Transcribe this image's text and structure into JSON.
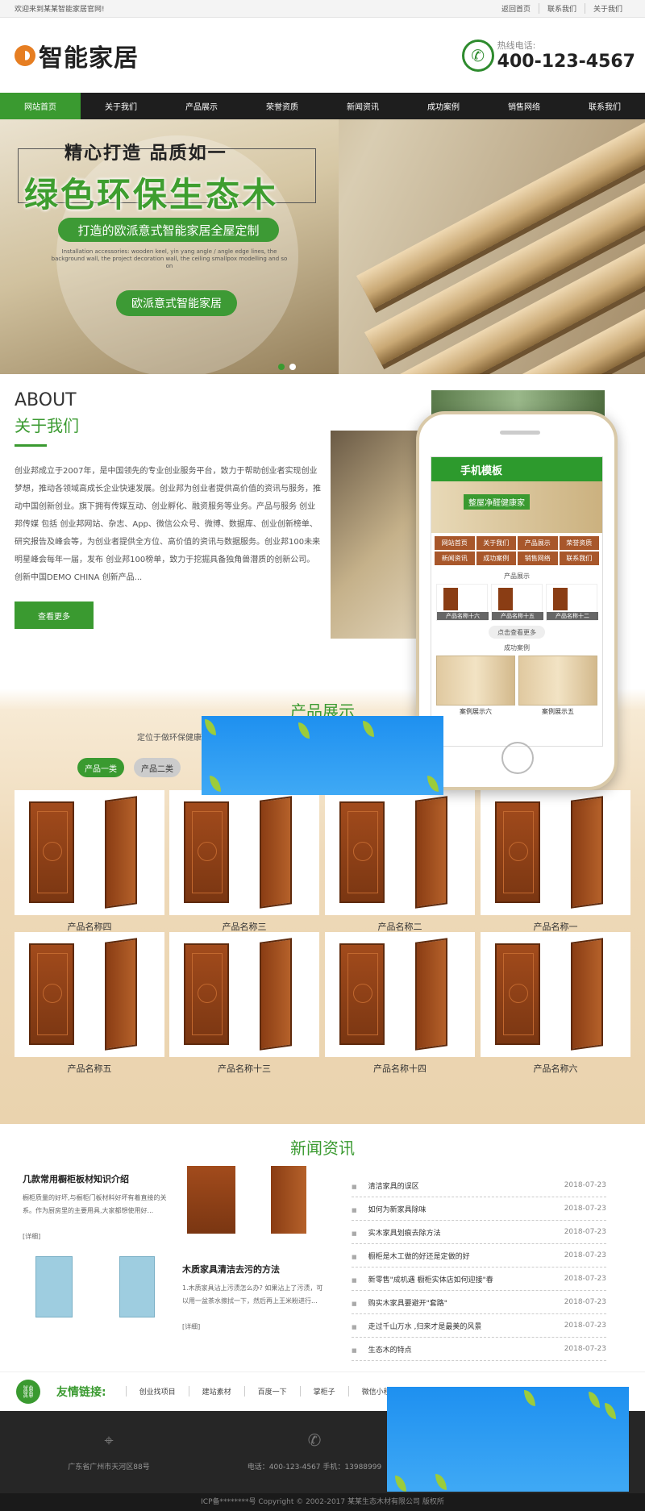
{
  "topbar": {
    "welcome": "欢迎来到某某智能家居官网!",
    "links": [
      "返回首页",
      "联系我们",
      "关于我们"
    ]
  },
  "header": {
    "logo_text": "智能家居",
    "hotline_label": "热线电话:",
    "hotline_number": "400-123-4567"
  },
  "nav": {
    "items": [
      "网站首页",
      "关于我们",
      "产品展示",
      "荣誉资质",
      "新闻资讯",
      "成功案例",
      "销售网络",
      "联系我们"
    ]
  },
  "banner": {
    "title1": "精心打造   品质如一",
    "title2": "绿色环保生态木",
    "pill1": "打造的欧派意式智能家居全屋定制",
    "english": "Installation accessories: wooden keel, yin yang angle / angle edge lines, the background wall, the project decoration wall, the ceiling smallpox modelling and so on",
    "pill2": "欧派意式智能家居"
  },
  "about": {
    "title_en": "ABOUT",
    "title_cn": "关于我们",
    "text": "创业邦成立于2007年，是中国领先的专业创业服务平台，致力于帮助创业者实现创业梦想，推动各领域高成长企业快速发展。创业邦为创业者提供高价值的资讯与服务，推动中国创新创业。旗下拥有传媒互动、创业孵化、融资服务等业务。产品与服务 创业邦传媒 包括 创业邦网站、杂志、App、微信公众号、微博、数据库、创业创新榜单、研究报告及峰会等，为创业者提供全方位、高价值的资讯与数据服务。创业邦100未来明星峰会每年一届，发布 创业邦100榜单，致力于挖掘具备独角兽潜质的创新公司。创新中国DEMO CHINA 创新产品...",
    "more_button": "查看更多"
  },
  "products": {
    "title": "产品展示",
    "subtitle": "定位于做环保健康",
    "tabs": [
      "产品一类",
      "产品二类"
    ],
    "items": [
      "产品名称四",
      "产品名称三",
      "产品名称二",
      "产品名称一",
      "产品名称五",
      "产品名称十三",
      "产品名称十四",
      "产品名称六"
    ]
  },
  "phone": {
    "header": "手机模板",
    "banner_text": "整屋净醛健康家",
    "nav": [
      "网站首页",
      "关于我们",
      "产品展示",
      "荣誉资质",
      "新闻资讯",
      "成功案例",
      "销售网络",
      "联系我们"
    ],
    "product_section": "产品展示",
    "products": [
      "产品名称十六",
      "产品名称十五",
      "产品名称十二"
    ],
    "more": "点击查看更多",
    "case_section": "成功案例",
    "cases": [
      "案例展示六",
      "案例展示五"
    ]
  },
  "news": {
    "title": "新闻资讯",
    "feature1_title": "几款常用橱柜板材知识介绍",
    "feature1_text": "橱柜质量的好坏,与橱柜门板材料好坏有着直接的关系。作为厨房里的主要用具,大家都想使用好...",
    "feature1_link": "[详细]",
    "feature2_title": "木质家具清洁去污的方法",
    "feature2_text": "1.木质家具沾上污渍怎么办? 如果沾上了污渍，可以用一盆茶水擦拭一下，然后再上王米粉进行...",
    "feature2_link": "[详细]",
    "list": [
      {
        "title": "清洁家具的误区",
        "date": "2018-07-23"
      },
      {
        "title": "如何为新家具除味",
        "date": "2018-07-23"
      },
      {
        "title": "实木家具划痕去除方法",
        "date": "2018-07-23"
      },
      {
        "title": "橱柜是木工做的好还是定做的好",
        "date": "2018-07-23"
      },
      {
        "title": "新零售\"成机遇 橱柜实体店如何迎接\"春",
        "date": "2018-07-23"
      },
      {
        "title": "购实木家具要避开\"套路\"",
        "date": "2018-07-23"
      },
      {
        "title": "走过千山万水 ,归来才是最美的风景",
        "date": "2018-07-23"
      },
      {
        "title": "生态木的特点",
        "date": "2018-07-23"
      }
    ]
  },
  "links": {
    "label": "友情链接:",
    "items": [
      "创业找项目",
      "建站素材",
      "百度一下",
      "掌柜子",
      "微信小程"
    ]
  },
  "footer": {
    "address": "广东省广州市天河区88号",
    "phone": "电话：400-123-4567 手机：13988999",
    "copyright": "ICP备********号 Copyright © 2002-2017 某某生态木材有限公司 版权所"
  },
  "colors": {
    "accent": "#3a9a30",
    "nav_bg": "#1e1e1e",
    "footer_bg": "#262626",
    "overlay_blue": "#1e90f0"
  }
}
